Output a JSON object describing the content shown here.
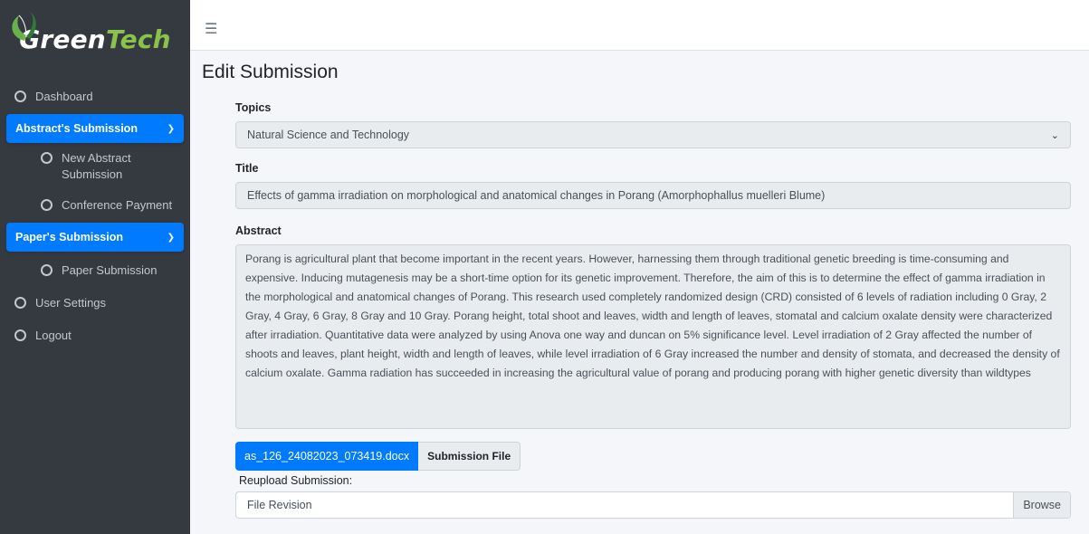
{
  "brand": {
    "name_g": "Green",
    "name_t": "Tech"
  },
  "sidebar": {
    "dashboard": "Dashboard",
    "abstract_group": "Abstract's Submission",
    "new_abstract": "New Abstract Submission",
    "conference_payment": "Conference Payment",
    "paper_group": "Paper's Submission",
    "paper_submission": "Paper Submission",
    "user_settings": "User Settings",
    "logout": "Logout"
  },
  "page": {
    "title": "Edit Submission"
  },
  "form": {
    "topics_label": "Topics",
    "topics_value": "Natural Science and Technology",
    "title_label": "Title",
    "title_value": "Effects of gamma irradiation on morphological and anatomical changes in Porang (Amorphophallus muelleri Blume)",
    "abstract_label": "Abstract",
    "abstract_value": "Porang is agricultural plant that become important in the recent years. However, harnessing them through traditional genetic breeding is time-consuming and expensive.  Inducing mutagenesis may be a short-time option for its genetic improvement. Therefore, the aim of this is to determine the effect of gamma irradiation in the morphological and anatomical changes of Porang. This research used completely randomized design (CRD) consisted of 6 levels of radiation including 0 Gray, 2 Gray, 4 Gray, 6 Gray, 8 Gray and 10 Gray. Porang height, total shoot and leaves, width and length of leaves, stomatal and calcium oxalate density were characterized after irradiation. Quantitative data were analyzed by using Anova one way and duncan on 5% significance level. Level irradiation of 2 Gray affected the number of shoots and leaves, plant height, width and length of leaves, while level irradiation of 6 Gray increased the number and density of stomata, and decreased the density of calcium oxalate. Gamma radiation has succeeded in increasing the agricultural value of porang and producing porang with higher genetic diversity than wildtypes",
    "file_name": "as_126_24082023_073419.docx",
    "file_tag": "Submission File",
    "reupload_label": "Reupload Submission:",
    "file_placeholder": "File Revision",
    "browse_label": "Browse"
  },
  "colors": {
    "sidebar_bg": "#343a40",
    "accent": "#007bff",
    "content_bg": "#f4f6f9"
  }
}
